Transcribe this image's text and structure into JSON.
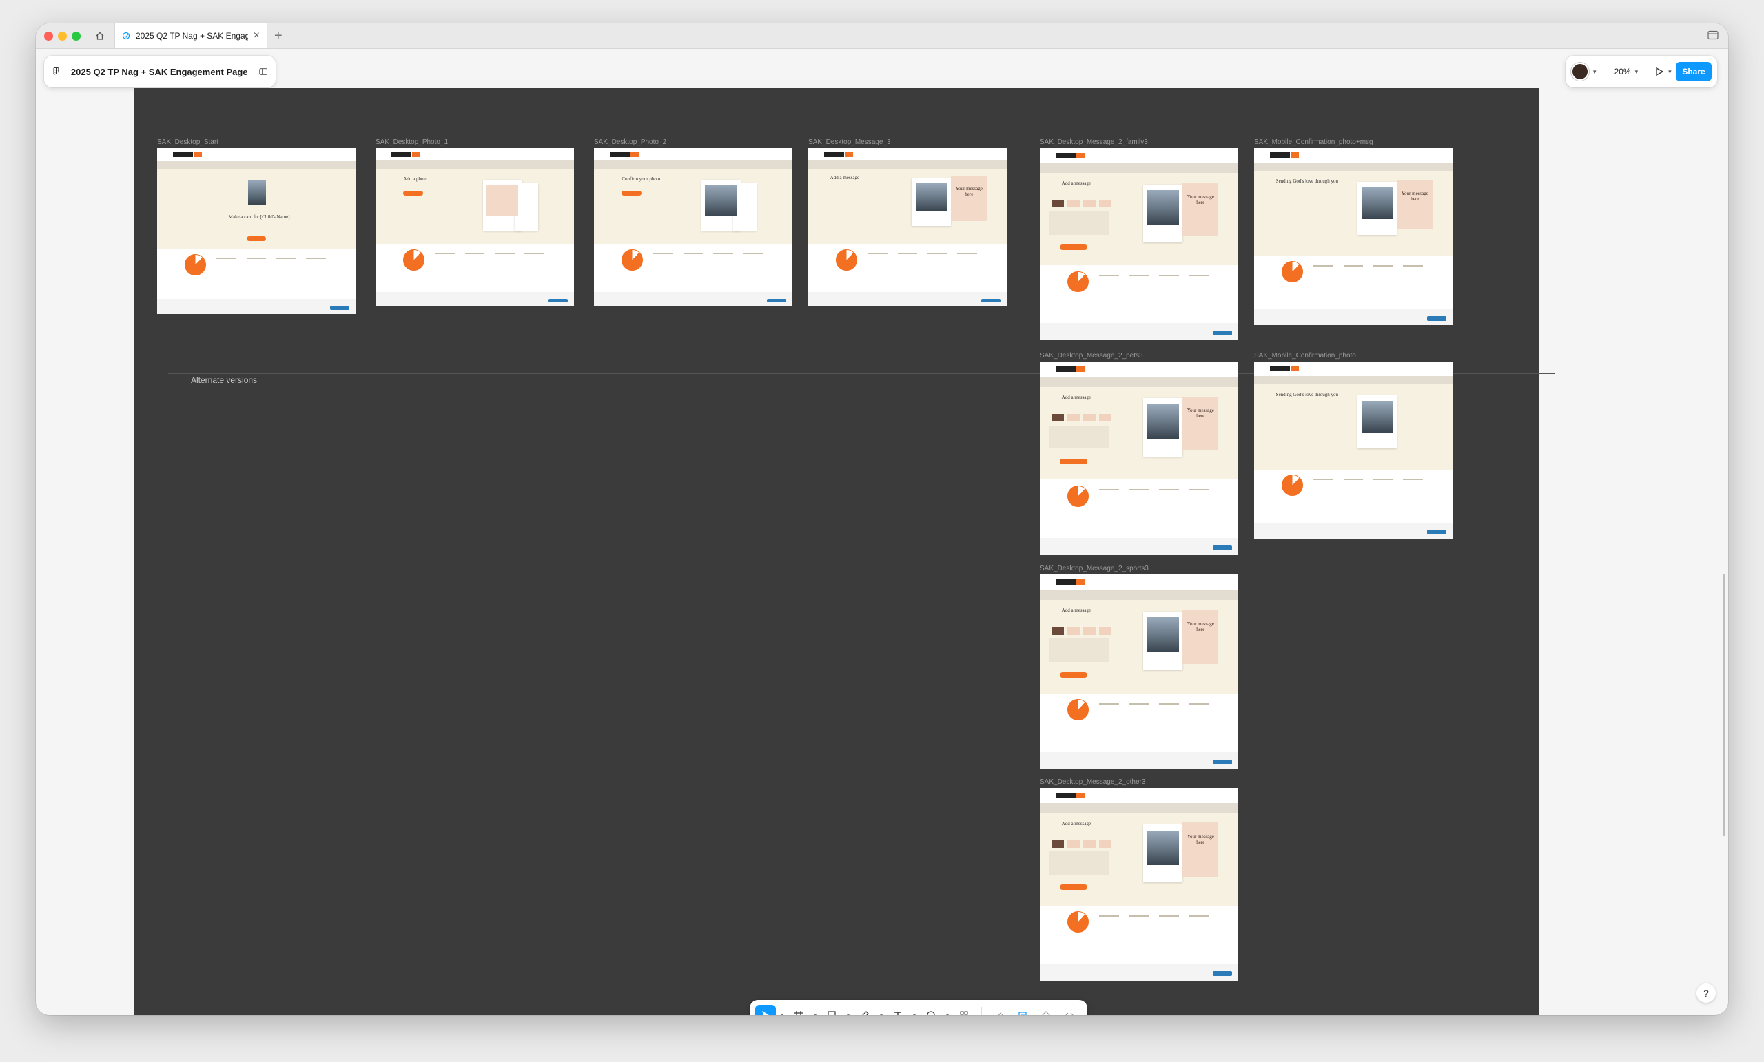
{
  "tab": {
    "title": "2025 Q2 TP Nag + SAK Engagement Page"
  },
  "file": {
    "name": "2025 Q2 TP Nag + SAK Engagement Page"
  },
  "toolbar_right": {
    "zoom": "20%",
    "share_label": "Share"
  },
  "canvas": {
    "section_label": "Alternate versions"
  },
  "frames": [
    {
      "label": "SAK_Desktop_Start",
      "heading": "Make a card for [Child's Name]"
    },
    {
      "label": "SAK_Desktop_Photo_1",
      "heading": "Add a photo"
    },
    {
      "label": "SAK_Desktop_Photo_2",
      "heading": "Confirm your photo"
    },
    {
      "label": "SAK_Desktop_Message_3",
      "heading": "Add a message",
      "message_text": "Your message here"
    },
    {
      "label": "SAK_Desktop_Message_2_family3",
      "heading": "Add a message",
      "message_text": "Your message here"
    },
    {
      "label": "SAK_Mobile_Confirmation_photo+msg",
      "heading": "Sending God's love through you",
      "message_text": "Your message here"
    },
    {
      "label": "SAK_Desktop_Message_2_pets3",
      "heading": "Add a message",
      "message_text": "Your message here"
    },
    {
      "label": "SAK_Mobile_Confirmation_photo",
      "heading": "Sending God's love through you"
    },
    {
      "label": "SAK_Desktop_Message_2_sports3",
      "heading": "Add a message",
      "message_text": "Your message here"
    },
    {
      "label": "SAK_Desktop_Message_2_other3",
      "heading": "Add a message",
      "message_text": "Your message here"
    }
  ],
  "icons": {
    "home": "home-icon",
    "figma": "figma-logo-icon",
    "sidebar": "sidebar-toggle-icon",
    "move": "move-cursor-icon",
    "frame": "frame-tool-icon",
    "shape": "rectangle-tool-icon",
    "pen": "pen-tool-icon",
    "text": "text-tool-icon",
    "comment": "comment-icon",
    "actions": "actions-icon",
    "play": "present-play-icon"
  },
  "colors": {
    "accent": "#0d99ff",
    "brand_orange": "#f36f21",
    "canvas": "#3b3b3b"
  }
}
